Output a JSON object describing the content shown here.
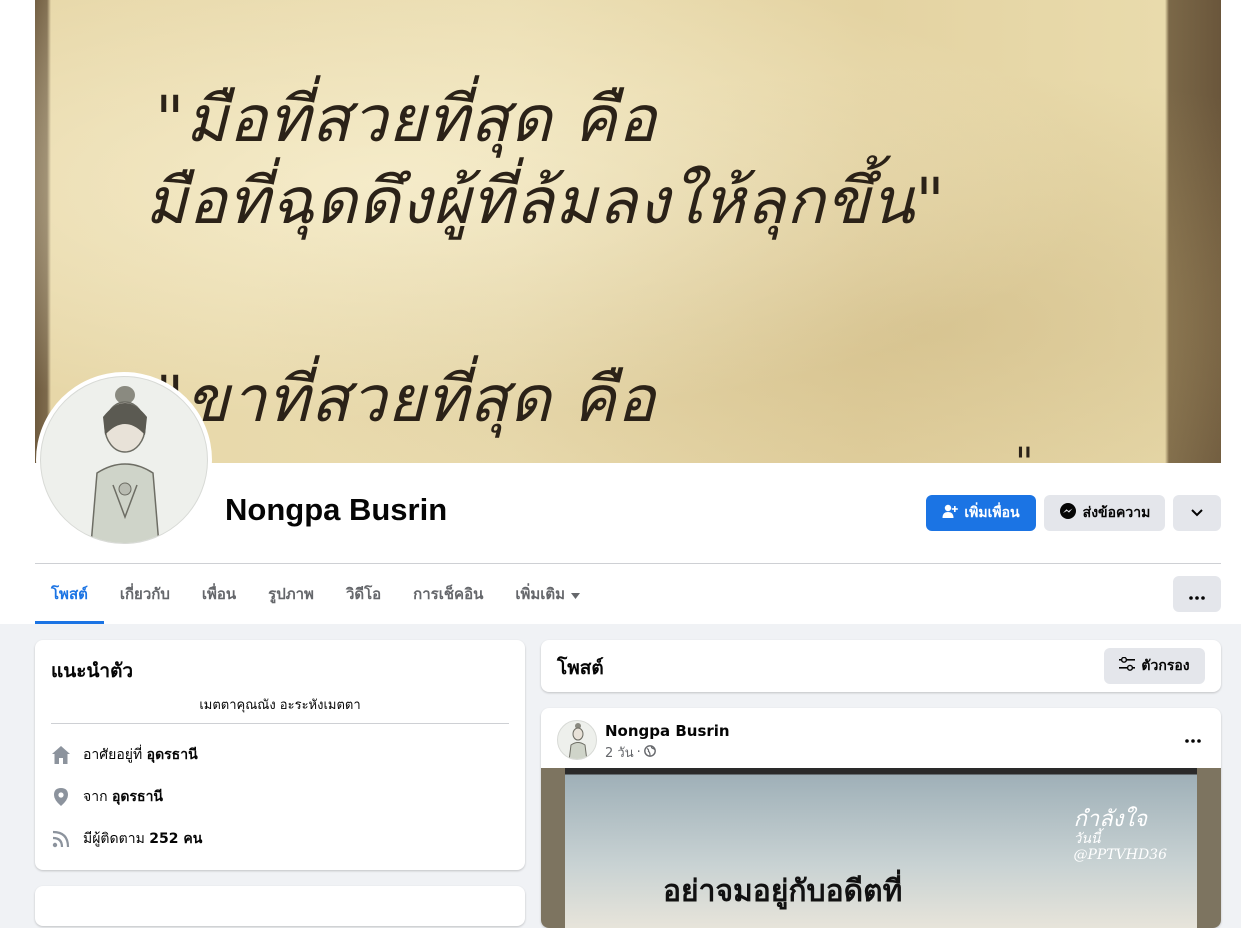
{
  "cover": {
    "lines": [
      "\"มือที่สวยที่สุด คือ",
      "มือที่ฉุดดึงผู้ที่ล้มลงให้ลุกขึ้น\"",
      "\"ขาที่สวยที่สุด คือ",
      "\""
    ]
  },
  "profile": {
    "name": "Nongpa Busrin",
    "add_friend_label": "เพิ่มเพื่อน",
    "message_label": "ส่งข้อความ"
  },
  "tabs": [
    "โพสต์",
    "เกี่ยวกับ",
    "เพื่อน",
    "รูปภาพ",
    "วิดีโอ",
    "การเช็คอิน",
    "เพิ่มเติม"
  ],
  "intro": {
    "title": "แนะนำตัว",
    "bio": "เมตตาคุณณัง อะระหังเมตตา",
    "lives_prefix": "อาศัยอยู่ที่",
    "lives_value": "อุดรธานี",
    "from_prefix": "จาก",
    "from_value": "อุดรธานี",
    "followers_prefix": "มีผู้ติดตาม",
    "followers_value": "252 คน"
  },
  "posts": {
    "title": "โพสต์",
    "filter_label": "ตัวกรอง",
    "items": [
      {
        "author": "Nongpa Busrin",
        "time": "2 วัน",
        "separator": "·",
        "image_text": "อย่าจมอยู่กับอดีตที่",
        "image_logo_1": "กำลังใจ",
        "image_logo_2": "วันนี้",
        "image_logo_3": "@PPTVHD36"
      }
    ]
  },
  "icons": {
    "add_friend": "add-friend-icon",
    "messenger": "messenger-icon",
    "chevron": "chevron-down-icon",
    "more": "more-dots-icon",
    "filter": "filter-icon",
    "home": "home-icon",
    "location": "location-pin-icon",
    "followers": "rss-icon",
    "globe": "globe-icon"
  },
  "colors": {
    "accent": "#1b74e4",
    "background": "#f0f2f5"
  }
}
